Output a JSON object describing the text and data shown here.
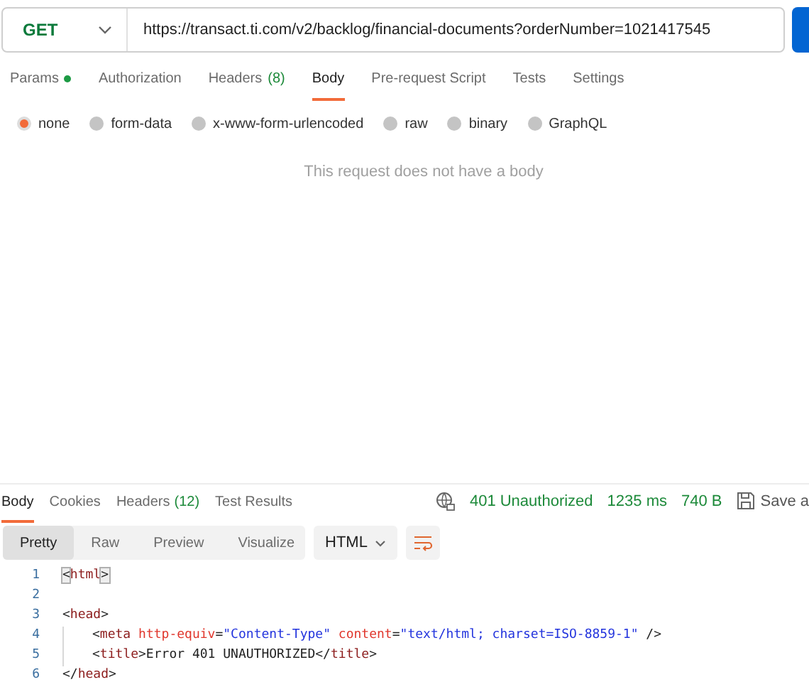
{
  "request": {
    "method": "GET",
    "url": "https://transact.ti.com/v2/backlog/financial-documents?orderNumber=1021417545"
  },
  "request_tabs": [
    {
      "label": "Params",
      "dot": true,
      "selected": false
    },
    {
      "label": "Authorization",
      "dot": false,
      "selected": false
    },
    {
      "label": "Headers",
      "count": "(8)",
      "dot": false,
      "selected": false
    },
    {
      "label": "Body",
      "dot": false,
      "selected": true
    },
    {
      "label": "Pre-request Script",
      "dot": false,
      "selected": false
    },
    {
      "label": "Tests",
      "dot": false,
      "selected": false
    },
    {
      "label": "Settings",
      "dot": false,
      "selected": false
    }
  ],
  "body_types": [
    {
      "label": "none",
      "selected": true
    },
    {
      "label": "form-data",
      "selected": false
    },
    {
      "label": "x-www-form-urlencoded",
      "selected": false
    },
    {
      "label": "raw",
      "selected": false
    },
    {
      "label": "binary",
      "selected": false
    },
    {
      "label": "GraphQL",
      "selected": false
    }
  ],
  "empty_message": "This request does not have a body",
  "response_tabs": [
    {
      "label": "Body",
      "selected": true
    },
    {
      "label": "Cookies",
      "selected": false
    },
    {
      "label": "Headers",
      "count": "(12)",
      "selected": false
    },
    {
      "label": "Test Results",
      "selected": false
    }
  ],
  "status": {
    "code": "401 Unauthorized",
    "time": "1235 ms",
    "size": "740 B",
    "save": "Save a"
  },
  "view_modes": [
    {
      "label": "Pretty",
      "selected": true
    },
    {
      "label": "Raw",
      "selected": false
    },
    {
      "label": "Preview",
      "selected": false
    },
    {
      "label": "Visualize",
      "selected": false
    }
  ],
  "format": "HTML",
  "code_lines": [
    {
      "number": "1",
      "indent": false,
      "tokens": [
        {
          "kind": "match",
          "text": "<"
        },
        {
          "kind": "tag",
          "text": "html"
        },
        {
          "kind": "match",
          "text": ">"
        }
      ]
    },
    {
      "number": "2",
      "indent": false
    },
    {
      "number": "3",
      "indent": false,
      "tokens": [
        {
          "kind": "punct",
          "text": "<"
        },
        {
          "kind": "tag",
          "text": "head"
        },
        {
          "kind": "punct",
          "text": ">"
        }
      ]
    },
    {
      "number": "4",
      "indent": true,
      "tokens": [
        {
          "kind": "punct",
          "text": "<"
        },
        {
          "kind": "tag",
          "text": "meta"
        },
        {
          "kind": "attr",
          "text": " http-equiv"
        },
        {
          "kind": "punct",
          "text": "="
        },
        {
          "kind": "string",
          "text": "\"Content-Type\""
        },
        {
          "kind": "attr",
          "text": " content"
        },
        {
          "kind": "punct",
          "text": "="
        },
        {
          "kind": "string",
          "text": "\"text/html; charset=ISO-8859-1\""
        },
        {
          "kind": "punct",
          "text": " />"
        }
      ]
    },
    {
      "number": "5",
      "indent": true,
      "tokens": [
        {
          "kind": "punct",
          "text": "<"
        },
        {
          "kind": "tag",
          "text": "title"
        },
        {
          "kind": "punct",
          "text": ">Error 401 UNAUTHORIZED</"
        },
        {
          "kind": "tag",
          "text": "title"
        },
        {
          "kind": "punct",
          "text": ">"
        }
      ]
    },
    {
      "number": "6",
      "indent": false,
      "tokens": [
        {
          "kind": "punct",
          "text": "</"
        },
        {
          "kind": "tag",
          "text": "head"
        },
        {
          "kind": "punct",
          "text": ">"
        }
      ]
    }
  ]
}
